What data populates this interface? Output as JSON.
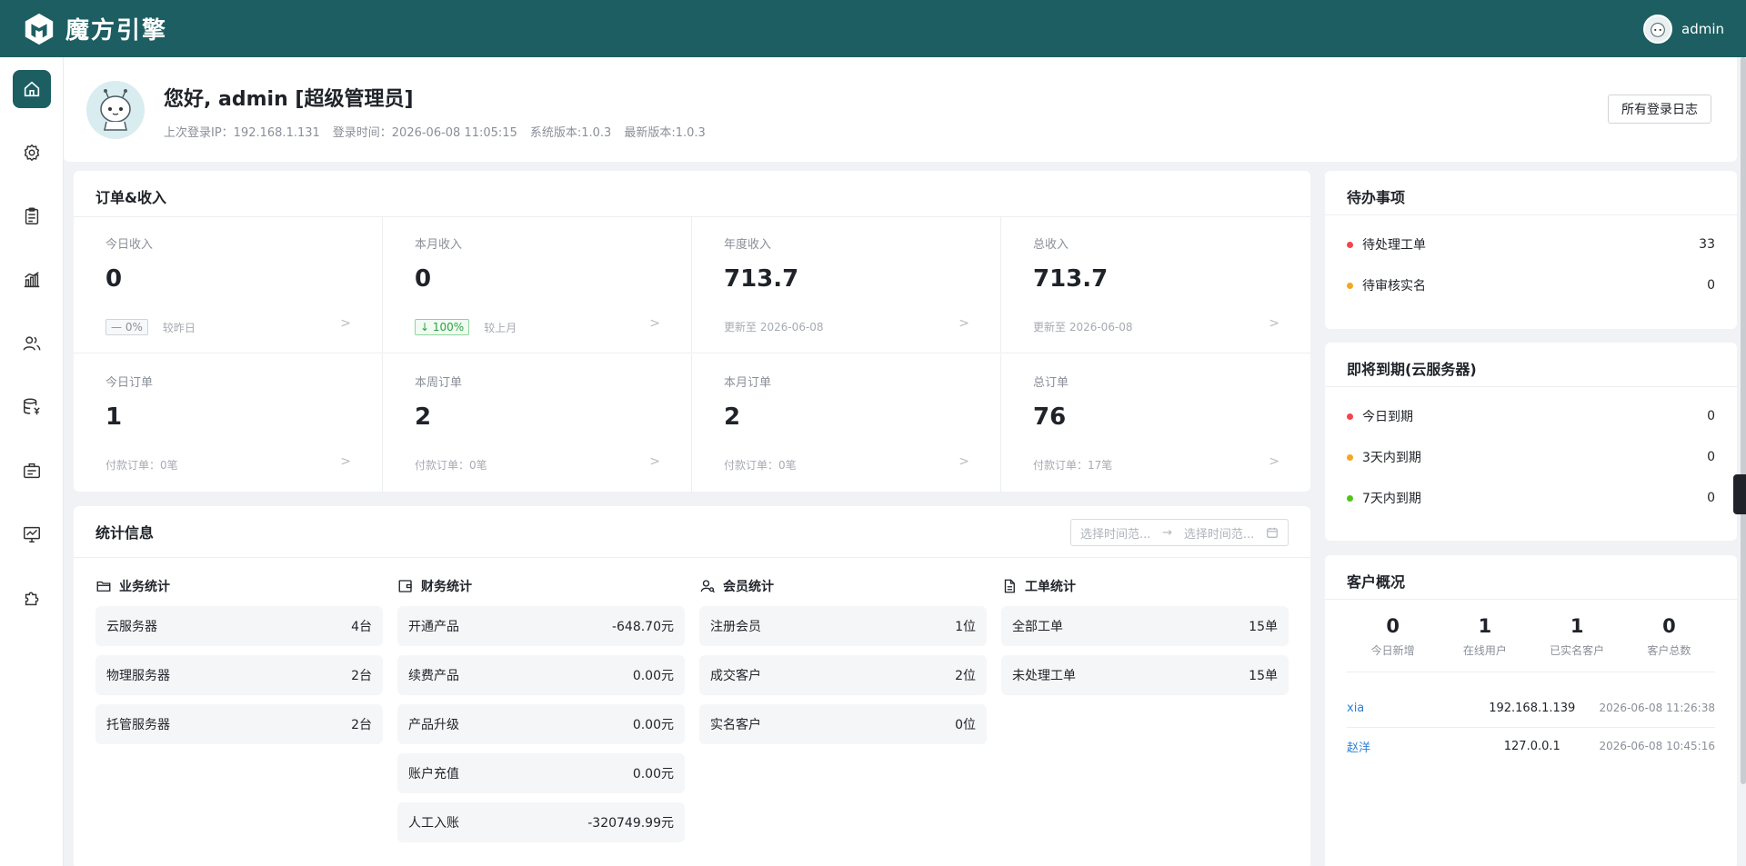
{
  "app": {
    "title": "魔方引擎",
    "user": "admin"
  },
  "sidebar": {
    "items": [
      {
        "icon": "home-icon"
      },
      {
        "icon": "gear-icon"
      },
      {
        "icon": "clipboard-icon"
      },
      {
        "icon": "bar-chart-icon"
      },
      {
        "icon": "users-icon"
      },
      {
        "icon": "database-yen-icon"
      },
      {
        "icon": "id-card-icon"
      },
      {
        "icon": "monitor-chart-icon"
      },
      {
        "icon": "puzzle-icon"
      }
    ]
  },
  "welcome": {
    "greeting": "您好, admin [超级管理员]",
    "last_ip": "上次登录IP：192.168.1.131",
    "login_time": "登录时间：2026-06-08 11:05:15",
    "version": "系统版本:1.0.3",
    "latest": "最新版本:1.0.3",
    "log_button": "所有登录日志"
  },
  "orders": {
    "title": "订单&收入",
    "cells": [
      {
        "label": "今日收入",
        "value": "0",
        "badge": "— 0%",
        "note": "较昨日"
      },
      {
        "label": "本月收入",
        "value": "0",
        "badge": "↓ 100%",
        "note": "较上月"
      },
      {
        "label": "年度收入",
        "value": "713.7",
        "note": "更新至 2026-06-08"
      },
      {
        "label": "总收入",
        "value": "713.7",
        "note": "更新至 2026-06-08"
      },
      {
        "label": "今日订单",
        "value": "1",
        "note": "付款订单：0笔"
      },
      {
        "label": "本周订单",
        "value": "2",
        "note": "付款订单：0笔"
      },
      {
        "label": "本月订单",
        "value": "2",
        "note": "付款订单：0笔"
      },
      {
        "label": "总订单",
        "value": "76",
        "note": "付款订单：17笔"
      }
    ]
  },
  "stats": {
    "title": "统计信息",
    "range_start": "选择时间范...",
    "range_sep": "→",
    "range_end": "选择时间范...",
    "business": {
      "title": "业务统计",
      "rows": [
        {
          "name": "云服务器",
          "value": "4台"
        },
        {
          "name": "物理服务器",
          "value": "2台"
        },
        {
          "name": "托管服务器",
          "value": "2台"
        }
      ]
    },
    "finance": {
      "title": "财务统计",
      "rows": [
        {
          "name": "开通产品",
          "value": "-648.70元"
        },
        {
          "name": "续费产品",
          "value": "0.00元"
        },
        {
          "name": "产品升级",
          "value": "0.00元"
        },
        {
          "name": "账户充值",
          "value": "0.00元"
        },
        {
          "name": "人工入账",
          "value": "-320749.99元"
        }
      ]
    },
    "members": {
      "title": "会员统计",
      "rows": [
        {
          "name": "注册会员",
          "value": "1位"
        },
        {
          "name": "成交客户",
          "value": "2位"
        },
        {
          "name": "实名客户",
          "value": "0位"
        }
      ]
    },
    "tickets": {
      "title": "工单统计",
      "rows": [
        {
          "name": "全部工单",
          "value": "15单"
        },
        {
          "name": "未处理工单",
          "value": "15单"
        }
      ]
    }
  },
  "todo": {
    "title": "待办事项",
    "items": [
      {
        "label": "待处理工单",
        "value": "33",
        "color": "#f5434e"
      },
      {
        "label": "待审核实名",
        "value": "0",
        "color": "#f5a623"
      }
    ]
  },
  "expire": {
    "title": "即将到期(云服务器)",
    "items": [
      {
        "label": "今日到期",
        "value": "0",
        "color": "#f5434e"
      },
      {
        "label": "3天内到期",
        "value": "0",
        "color": "#f5a623"
      },
      {
        "label": "7天内到期",
        "value": "0",
        "color": "#52c41a"
      }
    ]
  },
  "customer": {
    "title": "客户概况",
    "kpis": [
      {
        "value": "0",
        "label": "今日新增"
      },
      {
        "value": "1",
        "label": "在线用户"
      },
      {
        "value": "1",
        "label": "已实名客户"
      },
      {
        "value": "0",
        "label": "客户总数"
      }
    ],
    "logins": [
      {
        "name": "xia",
        "ip": "192.168.1.139",
        "time": "2026-06-08 11:26:38"
      },
      {
        "name": "赵洋",
        "ip": "127.0.0.1",
        "time": "2026-06-08 10:45:16"
      }
    ]
  },
  "colors": {
    "brand": "#1d5e62",
    "link": "#2b7fd6"
  }
}
